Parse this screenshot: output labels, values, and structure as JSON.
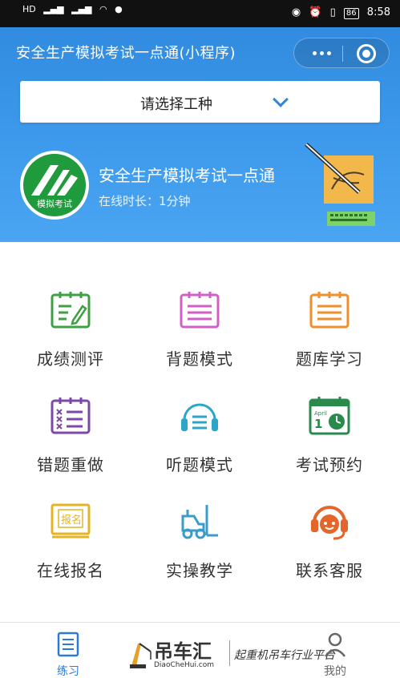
{
  "status_bar": {
    "left_items": [
      "HD",
      "4G",
      "4G",
      "wifi",
      "msg"
    ],
    "battery": "86",
    "time": "8:58"
  },
  "header": {
    "title": "安全生产模拟考试一点通(小程序)",
    "selector_label": "请选择工种"
  },
  "banner": {
    "logo_caption": "模拟考试",
    "title": "安全生产模拟考试一点通",
    "subtitle": "在线时长：1分钟"
  },
  "menu": [
    {
      "label": "成绩测评",
      "icon": "notebook-edit-icon",
      "color": "#3da043"
    },
    {
      "label": "背题模式",
      "icon": "notebook-list-icon",
      "color": "#d35fc6"
    },
    {
      "label": "题库学习",
      "icon": "notebook-list-icon",
      "color": "#ef8e2a"
    },
    {
      "label": "错题重做",
      "icon": "notebook-x-icon",
      "color": "#7b4aa8"
    },
    {
      "label": "听题模式",
      "icon": "headphones-icon",
      "color": "#2aa6c9"
    },
    {
      "label": "考试预约",
      "icon": "calendar-clock-icon",
      "color": "#2a8a4c"
    },
    {
      "label": "在线报名",
      "icon": "signup-icon",
      "color": "#e6b422"
    },
    {
      "label": "实操教学",
      "icon": "forklift-icon",
      "color": "#3a9cc8"
    },
    {
      "label": "联系客服",
      "icon": "customer-service-icon",
      "color": "#e4662a"
    }
  ],
  "tabbar": {
    "practice_label": "练习",
    "mine_label": "我的",
    "watermark_brand": "吊车汇",
    "watermark_domain": "DiaoCheHui.com",
    "watermark_slogan": "起重机吊车行业平台"
  },
  "colors": {
    "header_blue": "#2e88dd",
    "accent_blue": "#2c7ad6"
  }
}
